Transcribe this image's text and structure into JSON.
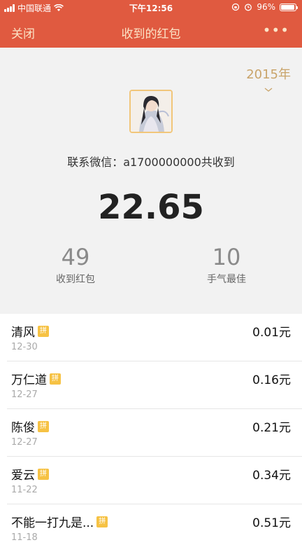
{
  "status_bar": {
    "carrier": "中国联通",
    "time": "下午12:56",
    "battery": "96%",
    "battery_level": 0.96
  },
  "nav": {
    "close_label": "关闭",
    "title": "收到的红包",
    "more_label": "•••"
  },
  "summary": {
    "year": "2015年",
    "sender_line": "联系微信：a1700000000共收到",
    "total": "22.65",
    "received_count": "49",
    "received_label": "收到红包",
    "best_count": "10",
    "best_label": "手气最佳"
  },
  "records": [
    {
      "name": "清风",
      "badge": "拼",
      "date": "12-30",
      "amount": "0.01元"
    },
    {
      "name": "万仁道",
      "badge": "拼",
      "date": "12-27",
      "amount": "0.16元"
    },
    {
      "name": "陈俊",
      "badge": "拼",
      "date": "12-27",
      "amount": "0.21元"
    },
    {
      "name": "爱云",
      "badge": "拼",
      "date": "11-22",
      "amount": "0.34元"
    },
    {
      "name": "不能一打九是...",
      "badge": "拼",
      "date": "11-18",
      "amount": "0.51元"
    }
  ],
  "colors": {
    "header": "#e05a40",
    "header_text": "#fbe3c6",
    "year_text": "#c9a46a",
    "badge": "#f6c244"
  }
}
